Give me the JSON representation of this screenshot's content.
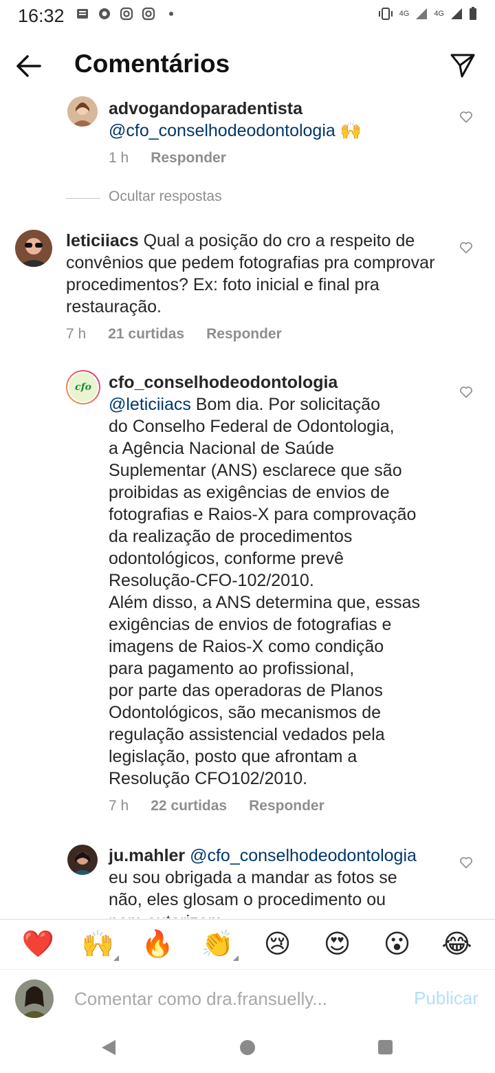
{
  "status_bar": {
    "time": "16:32",
    "network_a": "4G",
    "network_b": "4G"
  },
  "header": {
    "title": "Comentários"
  },
  "comments": [
    {
      "username": "advogandoparadentista",
      "mention": "@cfo_conselhodeodontologia",
      "text": "",
      "emoji": "🙌",
      "time": "1 h",
      "likes": "",
      "reply_label": "Responder"
    },
    {
      "username": "leticiiacs",
      "text": "Qual a posição do cro a respeito de convênios que pedem fotografias pra comprovar procedimentos? Ex: foto inicial e final pra restauração.",
      "time": "7 h",
      "likes": "21 curtidas",
      "reply_label": "Responder"
    },
    {
      "username": "cfo_conselhodeodontologia",
      "mention": "@leticiiacs",
      "avatar_text": "cfo",
      "text_lines": [
        " Bom dia. Por solicitação",
        "do Conselho Federal de Odontologia,",
        "a Agência Nacional de Saúde",
        "Suplementar (ANS) esclarece que são",
        "proibidas as exigências de envios de",
        "fotografias e Raios-X para comprovação",
        "da realização de procedimentos",
        "odontológicos, conforme prevê",
        "Resolução-CFO-102/2010.",
        "Além disso, a ANS determina que, essas",
        "exigências de envios de fotografias e",
        "imagens de Raios-X como condição",
        "para pagamento ao profissional,",
        "por parte das operadoras de Planos",
        "Odontológicos, são mecanismos de",
        "regulação assistencial vedados pela",
        "legislação, posto que afrontam a",
        "Resolução CFO102/2010."
      ],
      "time": "7 h",
      "likes": "22 curtidas",
      "reply_label": "Responder"
    },
    {
      "username": "ju.mahler",
      "mention": "@cfo_conselhodeodontologia",
      "text_lines": [
        "eu sou obrigada a mandar as fotos se",
        "não, eles glosam o procedimento ou",
        "nem autorizam"
      ]
    }
  ],
  "hide_replies_label": "Ocultar respostas",
  "emoji_bar": [
    "❤️",
    "🙌",
    "🔥",
    "👏",
    "😢",
    "😍",
    "😮",
    "😂"
  ],
  "composer": {
    "placeholder": "Comentar como dra.fransuelly...",
    "publish_label": "Publicar"
  },
  "colors": {
    "mention": "#00376b",
    "meta": "#8e8e8e",
    "publish_disabled": "#b2dffc"
  }
}
